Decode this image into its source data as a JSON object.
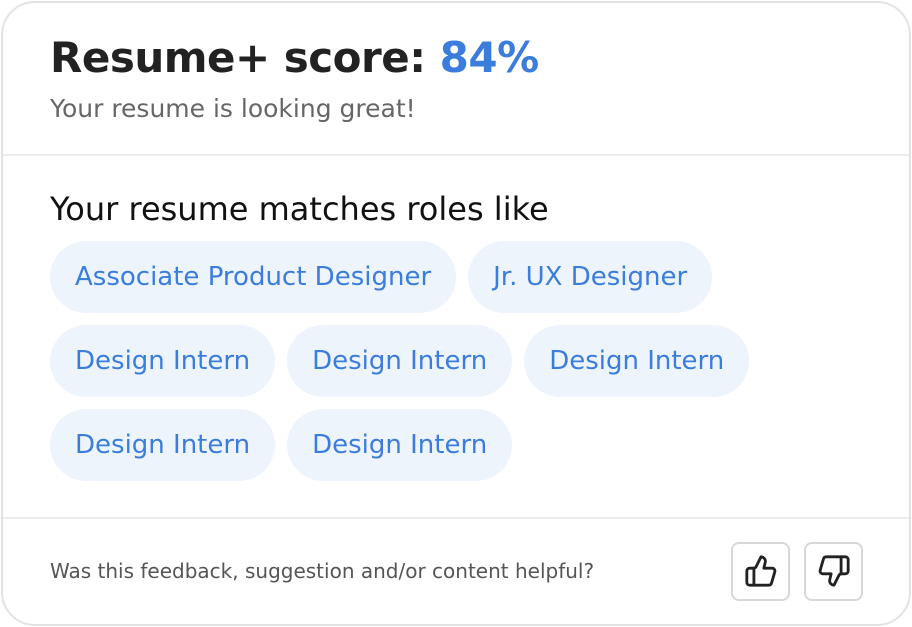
{
  "header": {
    "score_label": "Resume+ score: ",
    "score_value": "84%",
    "subtitle": "Your resume is looking great!"
  },
  "roles": {
    "title": "Your resume matches roles like",
    "items": [
      "Associate Product Designer",
      "Jr. UX Designer",
      "Design Intern",
      "Design Intern",
      "Design Intern",
      "Design Intern",
      "Design Intern"
    ]
  },
  "footer": {
    "question": "Was this feedback, suggestion and/or content helpful?",
    "thumbs_up_icon": "thumbs-up-icon",
    "thumbs_down_icon": "thumbs-down-icon"
  },
  "colors": {
    "accent": "#3b7ddd",
    "chip_background": "#eef4fc",
    "text_dark": "#222222",
    "text_muted": "#666666",
    "border": "#e3e3e3"
  }
}
